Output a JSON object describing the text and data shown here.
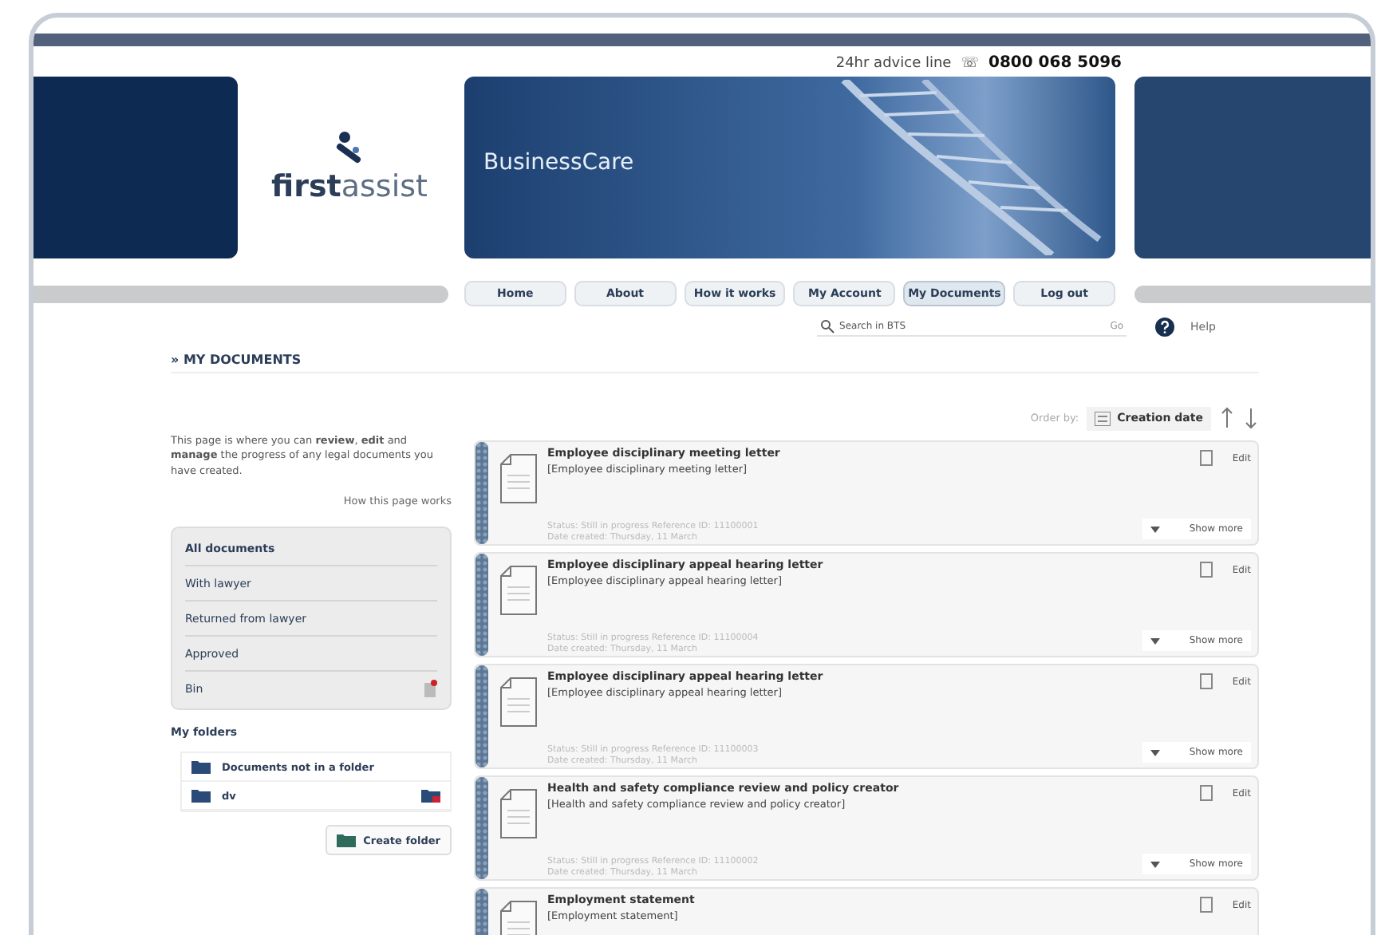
{
  "header": {
    "advice_label": "24hr advice line",
    "advice_icon": "☏",
    "advice_number": "0800 068 5096",
    "logo_bold": "first",
    "logo_light": "assist",
    "banner_title": "BusinessCare"
  },
  "nav": [
    {
      "label": "Home",
      "selected": false
    },
    {
      "label": "About",
      "selected": false
    },
    {
      "label": "How it works",
      "selected": false
    },
    {
      "label": "My Account",
      "selected": false
    },
    {
      "label": "My Documents",
      "selected": true
    },
    {
      "label": "Log out",
      "selected": false
    }
  ],
  "search": {
    "placeholder": "Search in BTS",
    "go": "Go"
  },
  "help": "Help",
  "section_title": "» MY DOCUMENTS",
  "intro": "This page is where you can **review**, **edit** and **manage** the progress of any legal documents you have created.",
  "how_link": "How this page works",
  "filters": [
    {
      "label": "All documents",
      "selected": true,
      "kind": "plain"
    },
    {
      "label": "With lawyer",
      "selected": false,
      "kind": "plain"
    },
    {
      "label": "Returned from lawyer",
      "selected": false,
      "kind": "plain"
    },
    {
      "label": "Approved",
      "selected": false,
      "kind": "plain"
    },
    {
      "label": "Bin",
      "selected": false,
      "kind": "bin"
    }
  ],
  "folders_title": "My folders",
  "folders": [
    {
      "label": "Documents not in a folder",
      "kind": "plain"
    },
    {
      "label": "dv",
      "kind": "deletable"
    }
  ],
  "create_folder": "Create folder",
  "order": {
    "label": "Order by:",
    "value": "Creation date"
  },
  "documents": [
    {
      "title": "Employee disciplinary meeting letter",
      "subtitle": "[Employee disciplinary meeting letter]",
      "status": "Status: Still in progress  Reference ID: 11100001",
      "date": "Date created: Thursday, 11 March",
      "edit": "Edit",
      "more": "Show more"
    },
    {
      "title": "Employee disciplinary appeal hearing letter",
      "subtitle": "[Employee disciplinary appeal hearing letter]",
      "status": "Status: Still in progress  Reference ID: 11100004",
      "date": "Date created: Thursday, 11 March",
      "edit": "Edit",
      "more": "Show more"
    },
    {
      "title": "Employee disciplinary appeal hearing letter",
      "subtitle": "[Employee disciplinary appeal hearing letter]",
      "status": "Status: Still in progress  Reference ID: 11100003",
      "date": "Date created: Thursday, 11 March",
      "edit": "Edit",
      "more": "Show more"
    },
    {
      "title": "Health and safety compliance review and policy creator",
      "subtitle": "[Health and safety compliance review and policy creator]",
      "status": "Status: Still in progress  Reference ID: 11100002",
      "date": "Date created: Thursday, 11 March",
      "edit": "Edit",
      "more": "Show more"
    },
    {
      "title": "Employment statement",
      "subtitle": "[Employment statement]",
      "edit": "Edit"
    }
  ]
}
